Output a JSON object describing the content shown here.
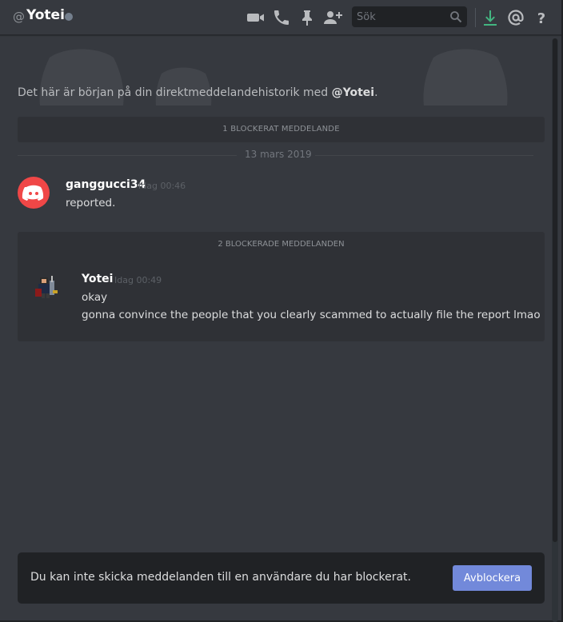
{
  "header": {
    "at_symbol": "@",
    "username": "Yotei",
    "status_color": "#747f8d",
    "search_placeholder": "Sök",
    "icons": [
      "video-icon",
      "phone-icon",
      "pin-icon",
      "add-user-icon",
      "search-icon",
      "download-icon",
      "mention-icon",
      "help-icon"
    ]
  },
  "intro": {
    "prefix": "Det här är början på din direktmeddelandehistorik med ",
    "mention": "@Yotei",
    "suffix": "."
  },
  "blocked_single": "1 BLOCKERAT MEDDELANDE",
  "date_divider": "13 mars 2019",
  "messages": [
    {
      "author": "ganggucci34",
      "time": "Idag 00:46",
      "lines": [
        "reported."
      ],
      "avatar": "discord-logo-avatar",
      "avatar_color": "#f04747"
    }
  ],
  "blocked_group": {
    "header": "2 BLOCKERADE MEDDELANDEN",
    "author": "Yotei",
    "time": "Idag 00:49",
    "lines": [
      "okay",
      "gonna convince the people that you clearly scammed to actually file the report lmao"
    ]
  },
  "bottom": {
    "text": "Du kan inte skicka meddelanden till en användare du har blockerat.",
    "button": "Avblockera",
    "button_color": "#7289da"
  }
}
